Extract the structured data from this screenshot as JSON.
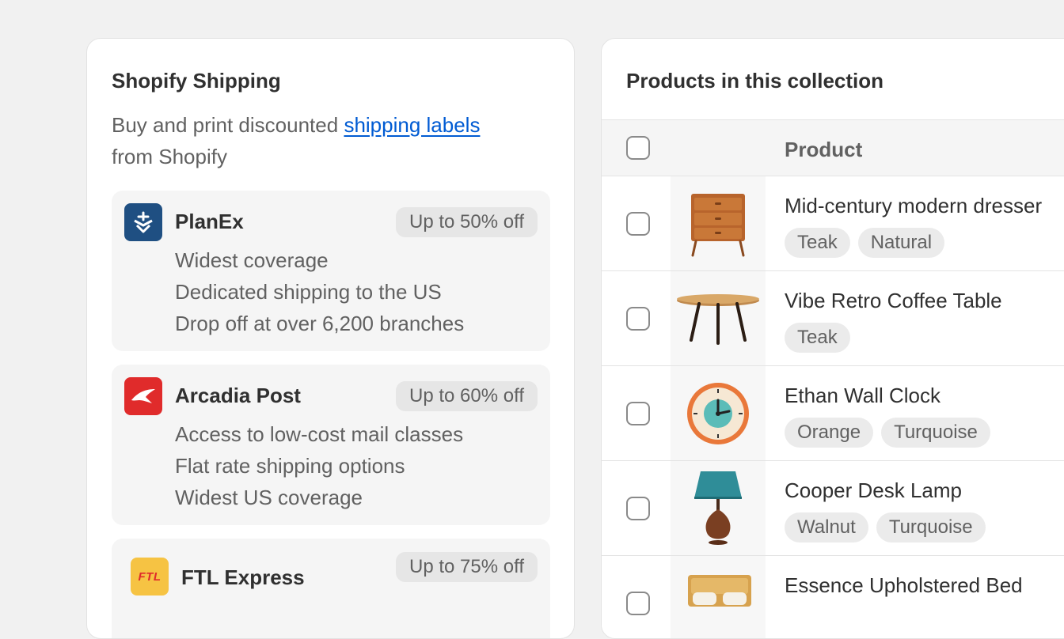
{
  "shipping": {
    "title": "Shopify Shipping",
    "desc_prefix": "Buy and print discounted",
    "desc_link": "shipping labels",
    "desc_suffix": "from Shopify",
    "carriers": [
      {
        "name": "PlanEx",
        "badge": "Up to 50% off",
        "logo_color": "#1f4f82",
        "icon": "planex-logo-icon",
        "features": [
          "Widest coverage",
          "Dedicated shipping to the US",
          "Drop off at over 6,200 branches"
        ]
      },
      {
        "name": "Arcadia Post",
        "badge": "Up to 60% off",
        "logo_color": "#e02b2b",
        "icon": "arcadia-post-logo-icon",
        "features": [
          "Access to low-cost mail classes",
          "Flat rate shipping options",
          "Widest US coverage"
        ]
      },
      {
        "name": "FTL Express",
        "badge": "Up to 75% off",
        "logo_color": "#f6c343",
        "icon": "ftl-express-logo-icon",
        "logo_text": "FTL",
        "features": []
      }
    ]
  },
  "products": {
    "title": "Products in this collection",
    "column_header": "Product",
    "rows": [
      {
        "name": "Mid-century modern dresser",
        "tags": [
          "Teak",
          "Natural"
        ],
        "icon": "dresser-image"
      },
      {
        "name": "Vibe Retro Coffee Table",
        "tags": [
          "Teak"
        ],
        "icon": "coffee-table-image"
      },
      {
        "name": "Ethan Wall Clock",
        "tags": [
          "Orange",
          "Turquoise"
        ],
        "icon": "wall-clock-image"
      },
      {
        "name": "Cooper Desk Lamp",
        "tags": [
          "Walnut",
          "Turquoise"
        ],
        "icon": "desk-lamp-image"
      },
      {
        "name": "Essence Upholstered Bed",
        "tags": [],
        "icon": "bed-image"
      }
    ]
  },
  "colors": {
    "background": "#f1f1f1",
    "card": "#ffffff",
    "link": "#005bd3",
    "text_primary": "#303030",
    "text_secondary": "#616161"
  }
}
